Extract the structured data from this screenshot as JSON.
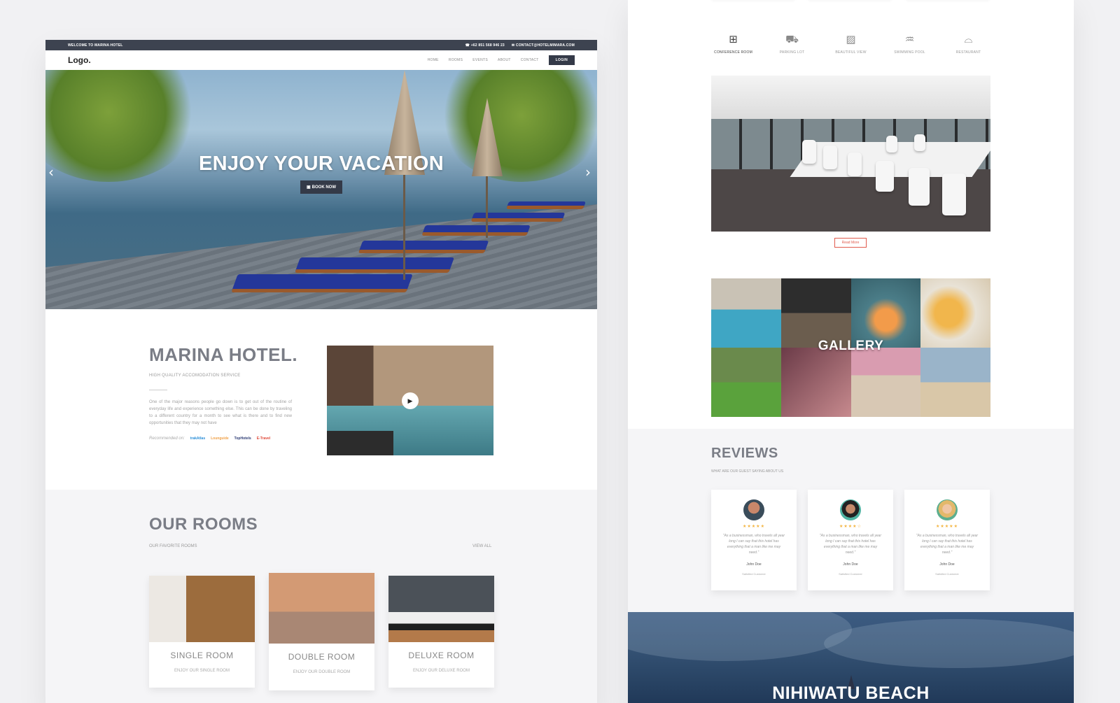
{
  "left": {
    "topbar": {
      "welcome": "WELCOME TO MARINA HOTEL",
      "phone": "☎ +62 851 568 946 23",
      "email": "✉ CONTACT@HOTELMIMARA.COM"
    },
    "navbar": {
      "logo": "Logo.",
      "items": [
        "HOME",
        "ROOMS",
        "EVENTS",
        "ABOUT",
        "CONTACT"
      ],
      "login": "LOGIN"
    },
    "hero": {
      "title": "ENJOY YOUR VACATION",
      "button": "BOOK NOW",
      "prev_icon": "chevron-left-icon",
      "next_icon": "chevron-right-icon"
    },
    "about": {
      "title": "MARINA HOTEL.",
      "subtitle": "HIGH QUALITY ACCOMODATION SERVICE",
      "body": "One of the major reasons people go down is to get out of the routine of everyday life and experience something else. This can be done by traveling to a different country for a month to see what is there and to find new opportunities that they may not have",
      "recommended_label": "Recommended on:",
      "partners": [
        {
          "name": "trakAtlas",
          "color": "#2a8ed8"
        },
        {
          "name": "Lounguide",
          "color": "#f0a24a"
        },
        {
          "name": "TopHotels",
          "color": "#2d3c74"
        },
        {
          "name": "E-Travel",
          "color": "#e04a3a"
        }
      ],
      "video_icon": "play-icon"
    },
    "rooms": {
      "title": "OUR ROOMS",
      "subtitle": "OUR FAVORITE ROOMS",
      "view_all": "VIEW ALL",
      "cards": [
        {
          "title": "SINGLE ROOM",
          "desc": "ENJOY OUR SINGLE ROOM"
        },
        {
          "title": "DOUBLE ROOM",
          "desc": "ENJOY OUR DOUBLE ROOM"
        },
        {
          "title": "DELUXE ROOM",
          "desc": "ENJOY OUR DELUXE ROOM"
        }
      ]
    }
  },
  "right": {
    "amenities": [
      {
        "label": "CONFERENCE ROOM",
        "icon": "conference-icon"
      },
      {
        "label": "PARKING LOT",
        "icon": "parking-icon"
      },
      {
        "label": "BEAUTIFUL VIEW",
        "icon": "view-icon"
      },
      {
        "label": "SWIMMING POOL",
        "icon": "pool-icon"
      },
      {
        "label": "RESTAURANT",
        "icon": "restaurant-icon"
      }
    ],
    "read_more": "Read More",
    "gallery_title": "GALLERY",
    "reviews": {
      "title": "REVIEWS",
      "subtitle": "WHAT ARE OUR GUEST SAYING ABOUT US",
      "cards": [
        {
          "stars": "★★★★★",
          "quote": "\"As a businessman, who travels all year long I can say that this hotel has everything that a man like me may need.\"",
          "name": "John Doe",
          "role": "Satisfied Customer"
        },
        {
          "stars": "★★★★☆",
          "quote": "\"As a businessman, who travels all year long I can say that this hotel has everything that a man like me may need.\"",
          "name": "John Doe",
          "role": "Satisfied Customer"
        },
        {
          "stars": "★★★★★",
          "quote": "\"As a businessman, who travels all year long I can say that this hotel has everything that a man like me may need.\"",
          "name": "John Doe",
          "role": "Satisfied Customer"
        }
      ]
    },
    "beach_title": "NIHIWATU BEACH"
  }
}
